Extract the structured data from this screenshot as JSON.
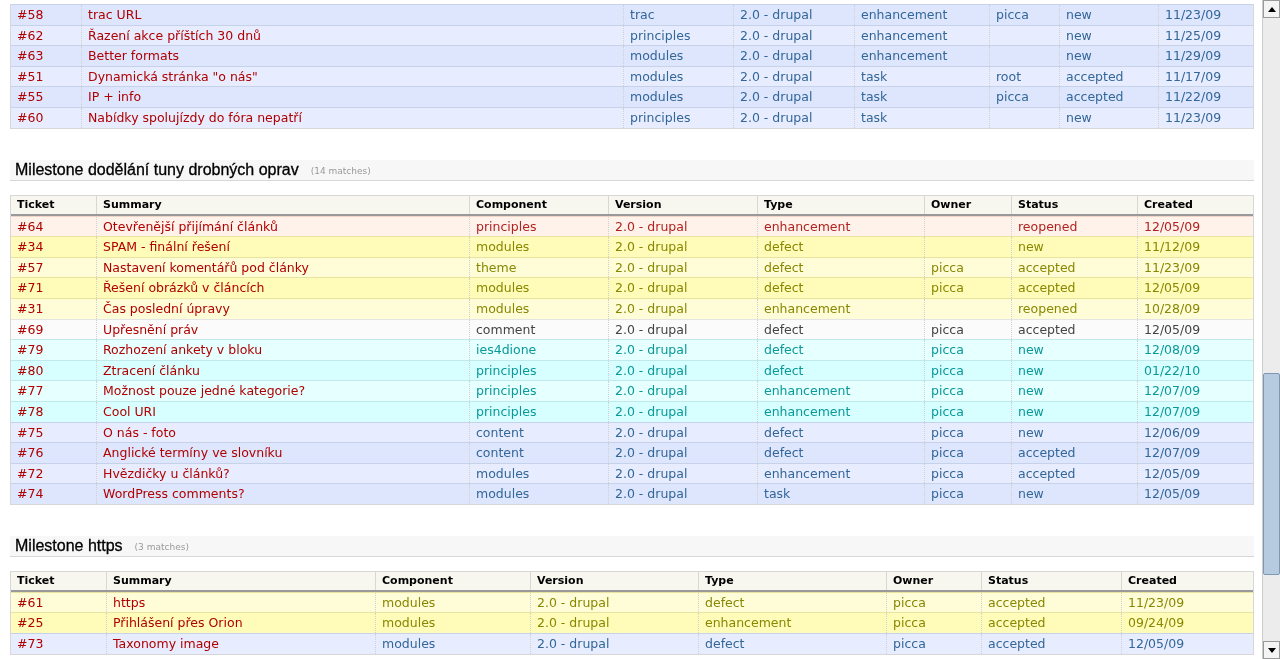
{
  "sections": [
    {
      "rows": [
        {
          "ticket": "#58",
          "summary": "trac URL",
          "component": "trac",
          "version": "2.0 - drupal",
          "type": "enhancement",
          "owner": "picca",
          "status": "new",
          "created": "11/23/09",
          "kind": "trivial"
        },
        {
          "ticket": "#62",
          "summary": "Řazení akce příštích 30 dnů",
          "component": "principles",
          "version": "2.0 - drupal",
          "type": "enhancement",
          "status": "new",
          "created": "11/25/09",
          "kind": "trivial"
        },
        {
          "ticket": "#63",
          "summary": "Better formats",
          "component": "modules",
          "version": "2.0 - drupal",
          "type": "enhancement",
          "status": "new",
          "created": "11/29/09",
          "kind": "trivial"
        },
        {
          "ticket": "#51",
          "summary": "Dynamická stránka \"o nás\"",
          "component": "modules",
          "version": "2.0 - drupal",
          "type": "task",
          "owner": "root",
          "status": "accepted",
          "created": "11/17/09",
          "kind": "trivial"
        },
        {
          "ticket": "#55",
          "summary": "IP + info",
          "component": "modules",
          "version": "2.0 - drupal",
          "type": "task",
          "owner": "picca",
          "status": "accepted",
          "created": "11/22/09",
          "kind": "trivial"
        },
        {
          "ticket": "#60",
          "summary": "Nabídky spolujízdy do fóra nepatří",
          "component": "principles",
          "version": "2.0 - drupal",
          "type": "task",
          "status": "new",
          "created": "11/23/09",
          "kind": "trivial"
        }
      ]
    },
    {
      "heading": "Milestone dodělání tuny drobných oprav",
      "matches": "(14 matches)",
      "columns": [
        "Ticket",
        "Summary",
        "Component",
        "Version",
        "Type",
        "Owner",
        "Status",
        "Created"
      ],
      "rows": [
        {
          "ticket": "#64",
          "summary": "Otevřenější přijímání článků",
          "component": "principles",
          "version": "2.0 - drupal",
          "type": "enhancement",
          "status": "reopened",
          "created": "12/05/09",
          "kind": "critical"
        },
        {
          "ticket": "#34",
          "summary": "SPAM - finální řešení",
          "component": "modules",
          "version": "2.0 - drupal",
          "type": "defect",
          "status": "new",
          "created": "11/12/09",
          "kind": "major"
        },
        {
          "ticket": "#57",
          "summary": "Nastavení komentářů pod články",
          "component": "theme",
          "version": "2.0 - drupal",
          "type": "defect",
          "owner": "picca",
          "status": "accepted",
          "created": "11/23/09",
          "kind": "major"
        },
        {
          "ticket": "#71",
          "summary": "Řešení obrázků v článcích",
          "component": "modules",
          "version": "2.0 - drupal",
          "type": "defect",
          "owner": "picca",
          "status": "accepted",
          "created": "12/05/09",
          "kind": "major"
        },
        {
          "ticket": "#31",
          "summary": "Čas poslední úpravy",
          "component": "modules",
          "version": "2.0 - drupal",
          "type": "enhancement",
          "status": "reopened",
          "created": "10/28/09",
          "kind": "major"
        },
        {
          "ticket": "#69",
          "summary": "Upřesnění práv",
          "component": "comment",
          "version": "2.0 - drupal",
          "type": "defect",
          "owner": "picca",
          "status": "accepted",
          "created": "12/05/09",
          "kind": "normal"
        },
        {
          "ticket": "#79",
          "summary": "Rozhození ankety v bloku",
          "component": "ies4dione",
          "version": "2.0 - drupal",
          "type": "defect",
          "owner": "picca",
          "status": "new",
          "created": "12/08/09",
          "kind": "minor"
        },
        {
          "ticket": "#80",
          "summary": "Ztracení článku",
          "component": "principles",
          "version": "2.0 - drupal",
          "type": "defect",
          "owner": "picca",
          "status": "new",
          "created": "01/22/10",
          "kind": "minor"
        },
        {
          "ticket": "#77",
          "summary": "Možnost pouze jedné kategorie?",
          "component": "principles",
          "version": "2.0 - drupal",
          "type": "enhancement",
          "owner": "picca",
          "status": "new",
          "created": "12/07/09",
          "kind": "minor"
        },
        {
          "ticket": "#78",
          "summary": "Cool URI",
          "component": "principles",
          "version": "2.0 - drupal",
          "type": "enhancement",
          "owner": "picca",
          "status": "new",
          "created": "12/07/09",
          "kind": "minor"
        },
        {
          "ticket": "#75",
          "summary": "O nás - foto",
          "component": "content",
          "version": "2.0 - drupal",
          "type": "defect",
          "owner": "picca",
          "status": "new",
          "created": "12/06/09",
          "kind": "trivial"
        },
        {
          "ticket": "#76",
          "summary": "Anglické termíny ve slovníku",
          "component": "content",
          "version": "2.0 - drupal",
          "type": "defect",
          "owner": "picca",
          "status": "accepted",
          "created": "12/07/09",
          "kind": "trivial"
        },
        {
          "ticket": "#72",
          "summary": "Hvězdičky u článků?",
          "component": "modules",
          "version": "2.0 - drupal",
          "type": "enhancement",
          "owner": "picca",
          "status": "accepted",
          "created": "12/05/09",
          "kind": "trivial"
        },
        {
          "ticket": "#74",
          "summary": "WordPress comments?",
          "component": "modules",
          "version": "2.0 - drupal",
          "type": "task",
          "owner": "picca",
          "status": "new",
          "created": "12/05/09",
          "kind": "trivial"
        }
      ]
    },
    {
      "heading": "Milestone https",
      "matches": "(3 matches)",
      "columns": [
        "Ticket",
        "Summary",
        "Component",
        "Version",
        "Type",
        "Owner",
        "Status",
        "Created"
      ],
      "rows": [
        {
          "ticket": "#61",
          "summary": "https",
          "component": "modules",
          "version": "2.0 - drupal",
          "type": "defect",
          "owner": "picca",
          "status": "accepted",
          "created": "11/23/09",
          "kind": "major"
        },
        {
          "ticket": "#25",
          "summary": "Přihlášení přes Orion",
          "component": "modules",
          "version": "2.0 - drupal",
          "type": "enhancement",
          "owner": "picca",
          "status": "accepted",
          "created": "09/24/09",
          "kind": "major"
        },
        {
          "ticket": "#73",
          "summary": "Taxonomy image",
          "component": "modules",
          "version": "2.0 - drupal",
          "type": "defect",
          "owner": "picca",
          "status": "accepted",
          "created": "12/05/09",
          "kind": "trivial"
        }
      ]
    }
  ]
}
